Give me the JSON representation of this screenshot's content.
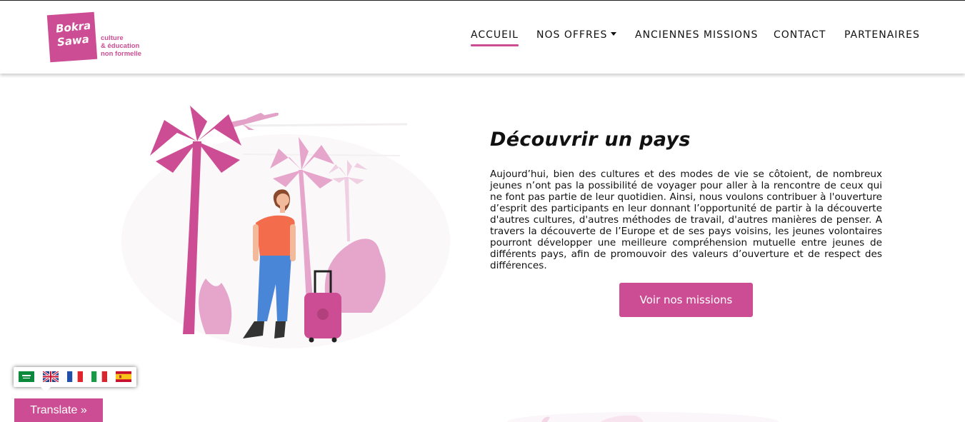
{
  "brand": {
    "logo_words": [
      "Bokra",
      "Sawa"
    ],
    "tagline": [
      "culture",
      "& éducation",
      "non formelle"
    ],
    "color": "#cc4d93"
  },
  "nav": {
    "items": [
      {
        "label": "ACCUEIL",
        "active": true
      },
      {
        "label": "NOS OFFRES",
        "dropdown": true
      },
      {
        "label": "ANCIENNES MISSIONS"
      },
      {
        "label": "CONTACT"
      },
      {
        "label": "PARTENAIRES"
      }
    ]
  },
  "main": {
    "title": "Découvrir un pays",
    "paragraph": "Aujourd’hui, bien des cultures et des modes de vie se côtoient, de nombreux jeunes n’ont pas la possibilité de voyager pour aller à la rencontre de ceux qui ne font pas partie de leur quotidien. Ainsi, nous voulons contribuer à l'ouverture d’esprit des participants en leur donnant l’opportunité de partir à la découverte d'autres cultures, d'autres méthodes de travail, d'autres manières de penser. A travers la découverte de l’Europe et de ses pays voisins, les jeunes volontaires pourront développer une meilleure compréhension mutuelle entre jeunes de différents pays, afin de promouvoir des valeurs d’ouverture et de respect des différences.",
    "button_label": "Voir nos missions"
  },
  "translate": {
    "flags": [
      "arabic-flag-icon",
      "english-flag-icon",
      "french-flag-icon",
      "italian-flag-icon",
      "spanish-flag-icon"
    ],
    "button_label": "Translate »"
  }
}
